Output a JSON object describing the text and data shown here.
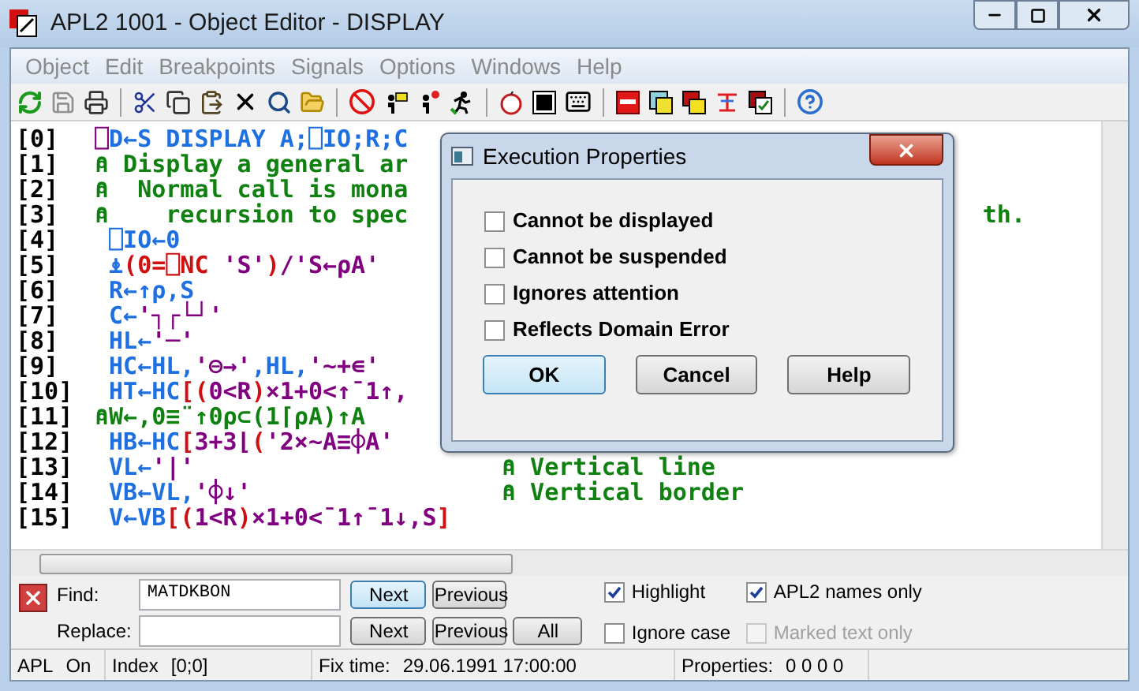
{
  "window": {
    "title": "APL2 1001 - Object Editor - DISPLAY"
  },
  "menu": [
    "Object",
    "Edit",
    "Breakpoints",
    "Signals",
    "Options",
    "Windows",
    "Help"
  ],
  "code_lines": [
    {
      "number": "[0]",
      "segments": [
        {
          "text": "⎕",
          "color": "#800080"
        },
        {
          "text": "D←S DISPLAY A;⎕IO;R;C",
          "color": "#1e6fe0"
        }
      ]
    },
    {
      "number": "[1]",
      "segments": [
        {
          "text": "⍝ Display a general ar",
          "color": "#108010"
        }
      ]
    },
    {
      "number": "[2]",
      "segments": [
        {
          "text": "⍝  Normal call is mona",
          "color": "#108010"
        }
      ]
    },
    {
      "number": "[3]",
      "segments": [
        {
          "text": "⍝    recursion to spec",
          "color": "#108010"
        }
      ],
      "tail": "th."
    },
    {
      "number": "[4]",
      "segments": [
        {
          "text": " ⎕IO←0",
          "color": "#1e6fe0"
        }
      ]
    },
    {
      "number": "[5]",
      "segments": [
        {
          "text": " ⍎",
          "color": "#1e6fe0"
        },
        {
          "text": "(0=⎕NC ",
          "color": "#d01010"
        },
        {
          "text": "'S'",
          "color": "#800080"
        },
        {
          "text": ")",
          "color": "#d01010"
        },
        {
          "text": "/'S←⍴A'",
          "color": "#800080"
        }
      ]
    },
    {
      "number": "[6]",
      "segments": [
        {
          "text": " R←↑⍴,S",
          "color": "#1e6fe0"
        }
      ]
    },
    {
      "number": "[7]",
      "segments": [
        {
          "text": " C←",
          "color": "#1e6fe0"
        },
        {
          "text": "'┐┌└┘'",
          "color": "#800080"
        }
      ]
    },
    {
      "number": "[8]",
      "segments": [
        {
          "text": " HL←",
          "color": "#1e6fe0"
        },
        {
          "text": "'─'",
          "color": "#800080"
        }
      ]
    },
    {
      "number": "[9]",
      "segments": [
        {
          "text": " HC←HL,",
          "color": "#1e6fe0"
        },
        {
          "text": "'⊖→'",
          "color": "#800080"
        },
        {
          "text": ",HL,",
          "color": "#1e6fe0"
        },
        {
          "text": "'~+∊'",
          "color": "#800080"
        }
      ]
    },
    {
      "number": "[10]",
      "segments": [
        {
          "text": " HT←HC",
          "color": "#1e6fe0"
        },
        {
          "text": "[(",
          "color": "#d01010"
        },
        {
          "text": "0<R",
          "color": "#800080"
        },
        {
          "text": ")",
          "color": "#d01010"
        },
        {
          "text": "×1+0<↑¯1↑,",
          "color": "#800080"
        }
      ]
    },
    {
      "number": "[11]",
      "segments": [
        {
          "text": "⍝W←,0≡¨↑0⍴⊂(1⌈⍴A)↑A",
          "color": "#108010"
        }
      ]
    },
    {
      "number": "[12]",
      "segments": [
        {
          "text": " HB←HC",
          "color": "#1e6fe0"
        },
        {
          "text": "[",
          "color": "#d01010"
        },
        {
          "text": "3+3⌊",
          "color": "#800080"
        },
        {
          "text": "(",
          "color": "#d01010"
        },
        {
          "text": "'2×~A≡⌽A'",
          "color": "#800080"
        }
      ]
    },
    {
      "number": "[13]",
      "segments": [
        {
          "text": " VL←",
          "color": "#1e6fe0"
        },
        {
          "text": "'|'",
          "color": "#800080"
        }
      ],
      "comment": "⍝ Vertical line"
    },
    {
      "number": "[14]",
      "segments": [
        {
          "text": " VB←VL,",
          "color": "#1e6fe0"
        },
        {
          "text": "'⌽↓'",
          "color": "#800080"
        }
      ],
      "comment": "⍝ Vertical border"
    },
    {
      "number": "[15]",
      "segments": [
        {
          "text": " V←VB",
          "color": "#1e6fe0"
        },
        {
          "text": "[(",
          "color": "#d01010"
        },
        {
          "text": "1<R",
          "color": "#800080"
        },
        {
          "text": ")",
          "color": "#d01010"
        },
        {
          "text": "×1+0<¯1↑¯1↓,S",
          "color": "#800080"
        },
        {
          "text": "]",
          "color": "#d01010"
        }
      ]
    }
  ],
  "dialog": {
    "title": "Execution Properties",
    "options": [
      {
        "label": "Cannot be displayed",
        "checked": false
      },
      {
        "label": "Cannot be suspended",
        "checked": false
      },
      {
        "label": "Ignores attention",
        "checked": false
      },
      {
        "label": "Reflects Domain Error",
        "checked": false
      }
    ],
    "buttons": [
      {
        "label": "OK",
        "selected": true
      },
      {
        "label": "Cancel",
        "selected": false
      },
      {
        "label": "Help",
        "selected": false
      }
    ]
  },
  "find_bar": {
    "find_label": "Find:",
    "find_value": "MATDKBON",
    "replace_label": "Replace:",
    "find_buttons": [
      {
        "label": "Next",
        "selected": true
      },
      {
        "label": "Previous",
        "selected": false
      }
    ],
    "replace_buttons": [
      {
        "label": "Next",
        "selected": false
      },
      {
        "label": "Previous",
        "selected": false
      },
      {
        "label": "All",
        "selected": false
      }
    ],
    "options": [
      {
        "label": "Highlight",
        "checked": true,
        "disabled": false
      },
      {
        "label": "APL2 names only",
        "checked": true,
        "disabled": false
      },
      {
        "label": "Ignore case",
        "checked": false,
        "disabled": false
      },
      {
        "label": "Marked text only",
        "checked": false,
        "disabled": true
      }
    ]
  },
  "status_bar": [
    {
      "label": "APL",
      "value": "On"
    },
    {
      "label": "Index",
      "value": "[0;0]"
    },
    {
      "label": "Fix time:",
      "value": "29.06.1991 17:00:00"
    },
    {
      "label": "Properties:",
      "value": "0 0 0 0"
    }
  ]
}
